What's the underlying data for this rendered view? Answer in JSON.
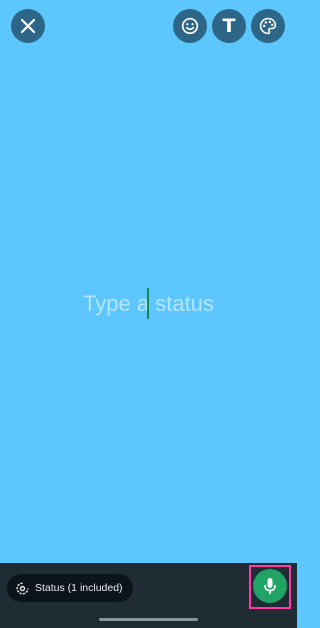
{
  "composer": {
    "placeholder": "Type a status",
    "value": ""
  },
  "toolbar": {
    "close_icon": "close-icon",
    "emoji_icon": "emoji-icon",
    "text_icon_glyph": "T",
    "palette_icon": "palette-icon"
  },
  "footer": {
    "audience_label": "Status (1 included)",
    "audience_icon": "status-ring-icon",
    "mic_icon": "mic-icon"
  },
  "colors": {
    "background": "#5cc6fd",
    "toolbar_button": "#2d6687",
    "bottom_bar": "#1f2c34",
    "chip": "#0b141a",
    "mic_button": "#21a366",
    "highlight": "#ff3aa8"
  }
}
